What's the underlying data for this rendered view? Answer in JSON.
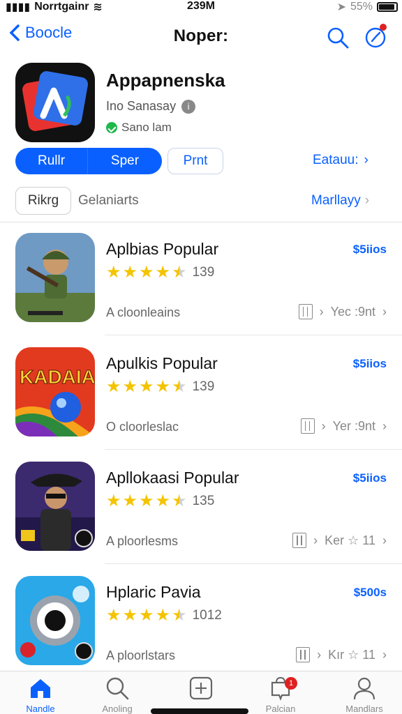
{
  "status_bar": {
    "carrier": "Norrtgainr",
    "time": "239M",
    "battery": "55%"
  },
  "nav": {
    "back_label": "Boocle",
    "title": "Noper:"
  },
  "hero": {
    "title": "Appapnenska",
    "subtitle": "Ino Sanasay",
    "status": "Sano lam",
    "segment_1": "Rullr",
    "segment_2": "Sper",
    "button": "Prnt",
    "link": "Eatauu:"
  },
  "filter": {
    "chip": "Rikrg",
    "label": "Gelaniarts",
    "link": "Marllayy"
  },
  "apps": [
    {
      "name": "Aplbias Popular",
      "price": "$5iios",
      "rating": 4.5,
      "count": "139",
      "meta": "A cloonleains",
      "actions": "Yec :9nt"
    },
    {
      "name": "Apulkis Popular",
      "price": "$5iios",
      "rating": 4.5,
      "count": "139",
      "meta": "O cloorleslac",
      "actions": "Yer :9nt"
    },
    {
      "name": "Apllokaasi Popular",
      "price": "$5iios",
      "rating": 4.5,
      "count": "135",
      "meta": "A ploorlesms",
      "actions": "Ker ☆ 11"
    },
    {
      "name": "Hplaric Pavia",
      "price": "$500s",
      "rating": 4.5,
      "count": "1012",
      "meta": "A ploorlstars",
      "actions": "Kır ☆ 11"
    }
  ],
  "tabs": [
    {
      "label": "Nandle"
    },
    {
      "label": "Anoling"
    },
    {
      "label": ""
    },
    {
      "label": "Palcian",
      "badge": "1"
    },
    {
      "label": "Mandlars"
    }
  ],
  "colors": {
    "accent": "#0a60ff",
    "star": "#f4c400",
    "badge": "#e02020",
    "check": "#1fb84a"
  }
}
